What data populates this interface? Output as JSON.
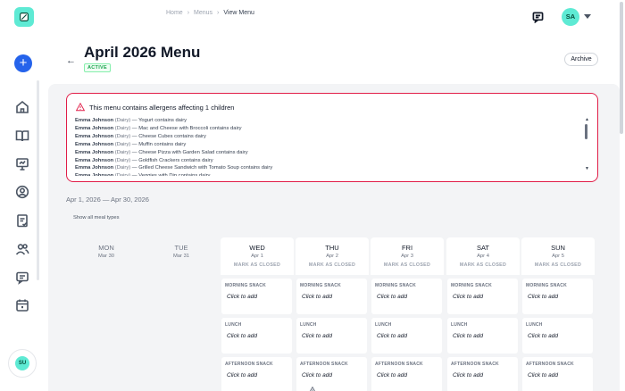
{
  "breadcrumb": {
    "home": "Home",
    "menus": "Menus",
    "current": "View Menu"
  },
  "user": {
    "initials": "SA",
    "sidebar_initials": "SU"
  },
  "header": {
    "title": "April 2026 Menu",
    "status": "ACTIVE",
    "archive_label": "Archive"
  },
  "alert": {
    "title": "This menu contains allergens affecting 1 children",
    "items": [
      {
        "name": "Emma Johnson",
        "allergen": "(Dairy)",
        "text": " — Yogurt contains dairy"
      },
      {
        "name": "Emma Johnson",
        "allergen": "(Dairy)",
        "text": " — Mac and Cheese with Broccoli contains dairy"
      },
      {
        "name": "Emma Johnson",
        "allergen": "(Dairy)",
        "text": " — Cheese Cubes contains dairy"
      },
      {
        "name": "Emma Johnson",
        "allergen": "(Dairy)",
        "text": " — Muffin contains dairy"
      },
      {
        "name": "Emma Johnson",
        "allergen": "(Dairy)",
        "text": " — Cheese Pizza with Garden Salad contains dairy"
      },
      {
        "name": "Emma Johnson",
        "allergen": "(Dairy)",
        "text": " — Goldfish Crackers contains dairy"
      },
      {
        "name": "Emma Johnson",
        "allergen": "(Dairy)",
        "text": " — Grilled Cheese Sandwich with Tomato Soup contains dairy"
      },
      {
        "name": "Emma Johnson",
        "allergen": "(Dairy)",
        "text": " — Veggies with Dip contains dairy"
      }
    ]
  },
  "date_range": "Apr 1, 2026 — Apr 30, 2026",
  "show_all_label": "Show all meal types",
  "days": [
    {
      "name": "MON",
      "date": "Mar 30",
      "active": false,
      "mark": ""
    },
    {
      "name": "TUE",
      "date": "Mar 31",
      "active": false,
      "mark": ""
    },
    {
      "name": "WED",
      "date": "Apr 1",
      "active": true,
      "mark": "MARK AS CLOSED"
    },
    {
      "name": "THU",
      "date": "Apr 2",
      "active": true,
      "mark": "MARK AS CLOSED"
    },
    {
      "name": "FRI",
      "date": "Apr 3",
      "active": true,
      "mark": "MARK AS CLOSED"
    },
    {
      "name": "SAT",
      "date": "Apr 4",
      "active": true,
      "mark": "MARK AS CLOSED"
    },
    {
      "name": "SUN",
      "date": "Apr 5",
      "active": true,
      "mark": "MARK AS CLOSED"
    }
  ],
  "meal_types": [
    "MORNING SNACK",
    "LUNCH",
    "AFTERNOON SNACK"
  ],
  "click_to_add": "Click to add",
  "colors": {
    "accent": "#5eead4",
    "primary": "#2563eb",
    "alert_border": "#e11d48",
    "active_badge": "#16a34a"
  },
  "sidebar_icons": [
    "home-icon",
    "book-icon",
    "presentation-icon",
    "user-circle-icon",
    "checklist-icon",
    "users-icon",
    "message-icon",
    "calendar-icon"
  ]
}
